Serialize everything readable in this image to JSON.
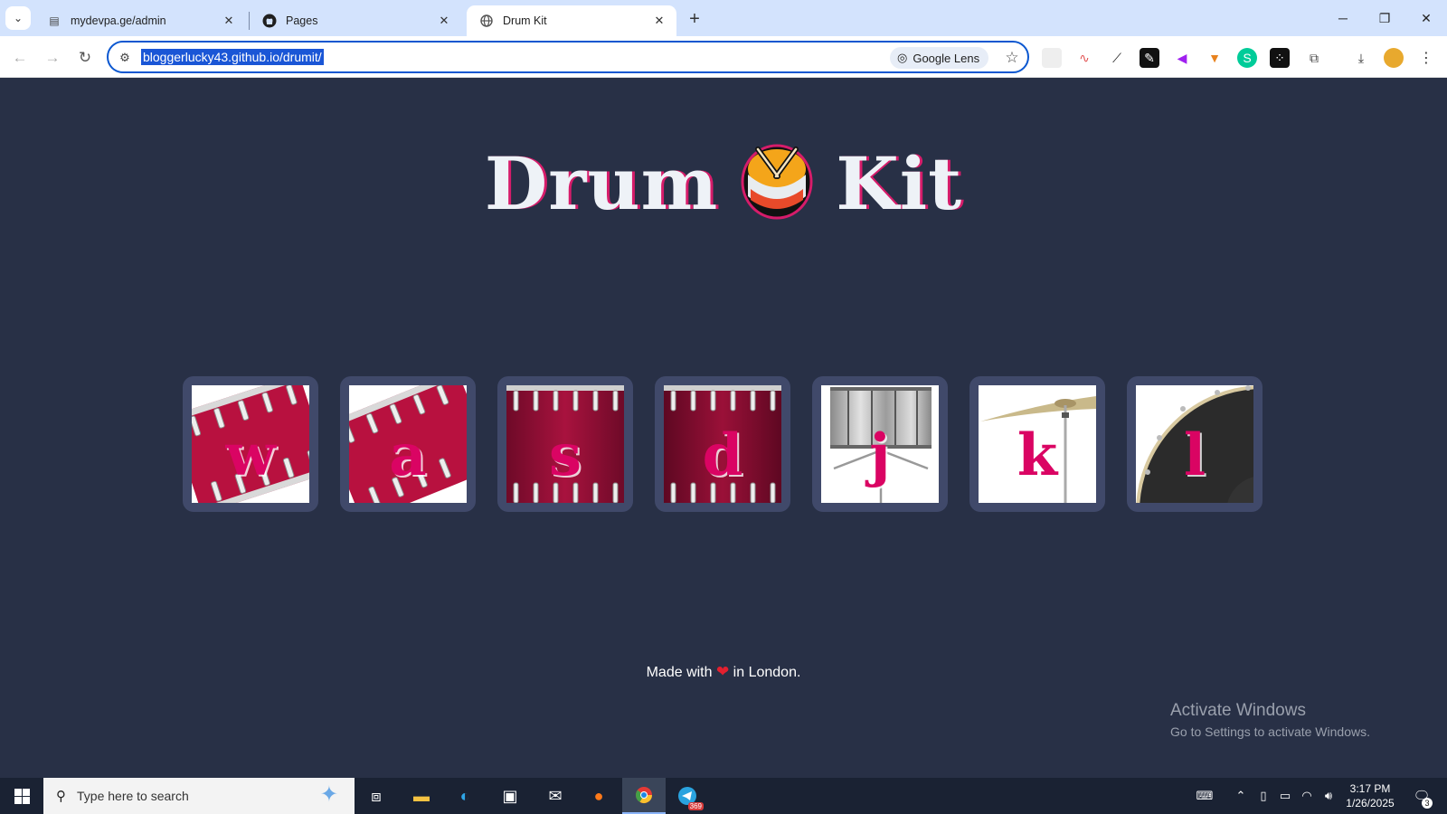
{
  "browser": {
    "tabs": [
      {
        "title": "mydevpa.ge/admin",
        "icon": "page-icon"
      },
      {
        "title": "Pages",
        "icon": "github-icon"
      },
      {
        "title": "Drum Kit",
        "icon": "globe-icon"
      }
    ],
    "url": "bloggerlucky43.github.io/drumit/",
    "lens_label": "Google Lens"
  },
  "page": {
    "title_left": "Drum",
    "title_right": "Kit",
    "drums": [
      {
        "key": "w",
        "type": "tom"
      },
      {
        "key": "a",
        "type": "tom"
      },
      {
        "key": "s",
        "type": "tom"
      },
      {
        "key": "d",
        "type": "tom"
      },
      {
        "key": "j",
        "type": "snare"
      },
      {
        "key": "k",
        "type": "crash"
      },
      {
        "key": "l",
        "type": "kick"
      }
    ],
    "footer_prefix": "Made with",
    "footer_suffix": "in London."
  },
  "watermark": {
    "line1": "Activate Windows",
    "line2": "Go to Settings to activate Windows."
  },
  "taskbar": {
    "search_placeholder": "Type here to search",
    "time": "3:17 PM",
    "date": "1/26/2025",
    "telegram_badge": "369",
    "notification_count": "3"
  },
  "colors": {
    "page_bg": "#283046",
    "key_letter": "#da0463",
    "drum_red": "#b8113f",
    "pad_border": "#40496a"
  }
}
